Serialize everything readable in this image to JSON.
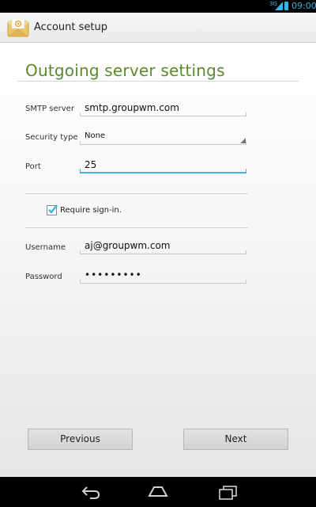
{
  "status_bar": {
    "network": "3G",
    "time": "09:00",
    "icons": [
      "signal-icon",
      "battery-icon"
    ]
  },
  "action_bar": {
    "app_icon": "email-envelope-icon",
    "title": "Account setup"
  },
  "form": {
    "heading": "Outgoing server settings",
    "smtp_server": {
      "label": "SMTP server",
      "value": "smtp.groupwm.com"
    },
    "security_type": {
      "label": "Security type",
      "value": "None"
    },
    "port": {
      "label": "Port",
      "value": "25"
    },
    "require_signin": {
      "label": "Require sign-in.",
      "checked": true
    },
    "username": {
      "label": "Username",
      "value": "aj@groupwm.com"
    },
    "password": {
      "label": "Password",
      "value": "•••••••••"
    }
  },
  "buttons": {
    "previous": "Previous",
    "next": "Next"
  },
  "nav_bar": {
    "icons": [
      "back-icon",
      "home-icon",
      "recent-apps-icon"
    ]
  },
  "colors": {
    "accent": "#33b5e5",
    "heading": "#5a8a2a",
    "checkbox": "#33b5e5"
  }
}
